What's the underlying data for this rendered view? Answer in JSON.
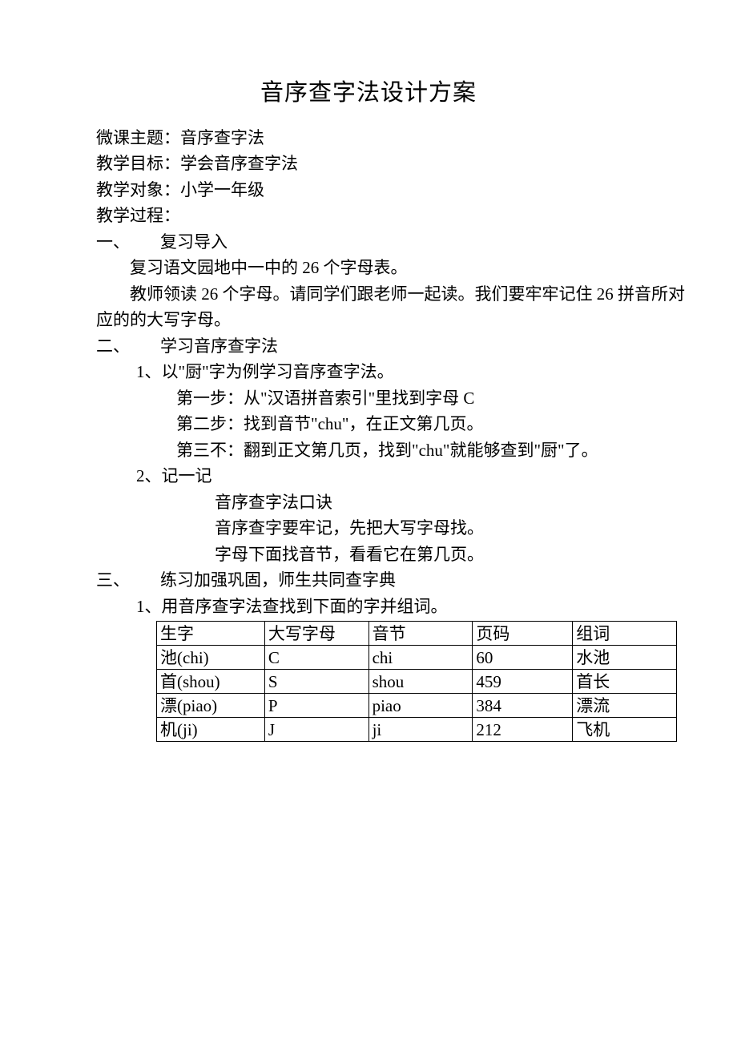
{
  "title": "音序查字法设计方案",
  "meta": {
    "topic_label": "微课主题：",
    "topic_value": "音序查字法",
    "goal_label": "教学目标：",
    "goal_value": "学会音序查字法",
    "target_label": "教学对象：",
    "target_value": "小学一年级",
    "process_label": "教学过程："
  },
  "section1": {
    "num": "一、",
    "title": "复习导入",
    "line1": "复习语文园地中一中的 26 个字母表。",
    "line2": "教师领读 26 个字母。请同学们跟老师一起读。我们要牢牢记住 26 拼音所对",
    "line3": "应的的大写字母。"
  },
  "section2": {
    "num": "二、",
    "title": "学习音序查字法",
    "item1": {
      "num": "1、",
      "title": "以\"厨\"字为例学习音序查字法。",
      "step1": "第一步：从\"汉语拼音索引\"里找到字母 C",
      "step2": "第二步：找到音节\"chu\"，在正文第几页。",
      "step3": "第三不：翻到正文第几页，找到\"chu\"就能够查到\"厨\"了。"
    },
    "item2": {
      "num": "2、",
      "title": "记一记",
      "line1": "音序查字法口诀",
      "line2": "音序查字要牢记，先把大写字母找。",
      "line3": "字母下面找音节，看看它在第几页。"
    }
  },
  "section3": {
    "num": "三、",
    "title": "练习加强巩固，师生共同查字典",
    "item1": "1、用音序查字法查找到下面的字并组词。"
  },
  "table": {
    "headers": [
      "生字",
      "大写字母",
      "音节",
      "页码",
      "组词"
    ],
    "rows": [
      [
        "池(chi)",
        "C",
        "chi",
        "60",
        "水池"
      ],
      [
        "首(shou)",
        "S",
        "shou",
        "459",
        "首长"
      ],
      [
        "漂(piao)",
        "P",
        "piao",
        "384",
        "漂流"
      ],
      [
        "机(ji)",
        "J",
        "ji",
        "212",
        "飞机"
      ]
    ]
  }
}
